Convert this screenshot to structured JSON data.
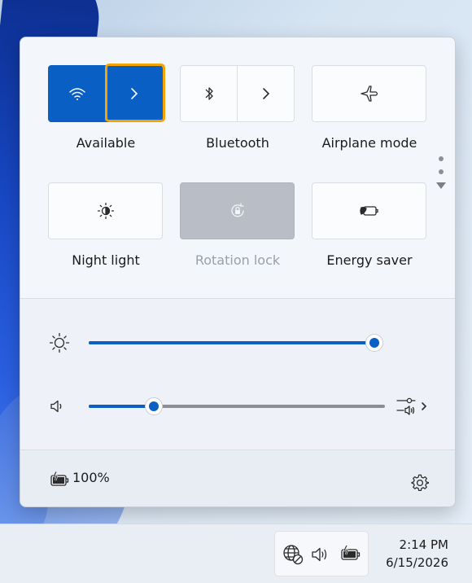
{
  "quick_settings": {
    "tiles_row1": [
      {
        "label": "Available",
        "icon": "wifi-icon",
        "state": "on"
      },
      {
        "label": "Bluetooth",
        "icon": "bluetooth-icon",
        "state": "off"
      },
      {
        "label": "Airplane mode",
        "icon": "airplane-icon",
        "state": "off"
      }
    ],
    "tiles_row2": [
      {
        "label": "Night light",
        "icon": "night-light-icon",
        "state": "off"
      },
      {
        "label": "Rotation lock",
        "icon": "rotation-lock-icon",
        "state": "disabled"
      },
      {
        "label": "Energy saver",
        "icon": "energy-saver-icon",
        "state": "off"
      }
    ],
    "brightness_level": 1.0,
    "volume_level": 0.22,
    "battery_text": "100%",
    "accent_color": "#0a5fc4",
    "focus_color": "#f5a300"
  },
  "taskbar": {
    "tray_icons": [
      "network-icon",
      "volume-icon",
      "battery-icon"
    ],
    "time": "2:14 PM",
    "date": "6/15/2026"
  }
}
